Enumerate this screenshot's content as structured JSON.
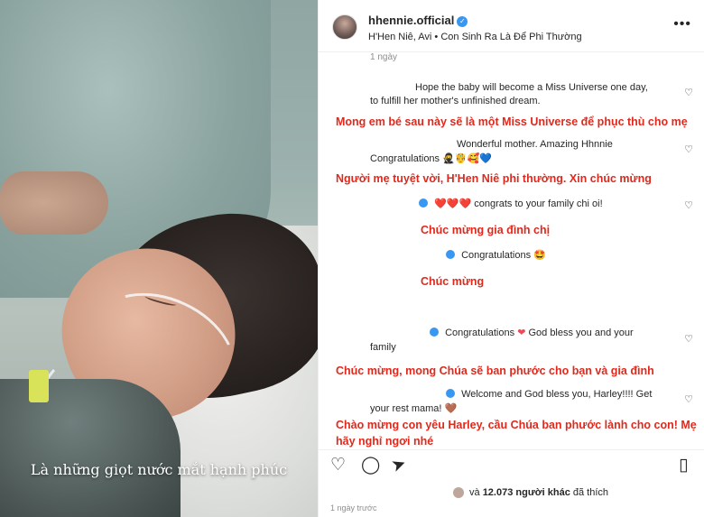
{
  "media": {
    "caption": "Là những giọt nước mắt hạnh phúc"
  },
  "header": {
    "username": "hhennie.official",
    "subtitle": "H'Hen Niê, Avi • Con Sinh Ra Là Để Phi Thường",
    "more_icon": "more-horizontal-icon"
  },
  "comments": {
    "top_timestamp": "1 ngày",
    "c1": {
      "en_line1": "Hope the baby will become a Miss Universe one day,",
      "en_line2": "to fulfill her mother's unfinished dream.",
      "vi": "Mong em bé sau này sẽ là một Miss Universe để phục thù cho mẹ"
    },
    "c2": {
      "en_line1": "Wonderful mother. Amazing Hhnnie",
      "en_line2": "Congratulations",
      "en_emoji": "🥷🤴🥰💙",
      "vi": "Người mẹ tuyệt vời, H'Hen Niê phi thường. Xin chúc mừng"
    },
    "c3": {
      "hearts": "❤️❤️❤️",
      "en": "congrats to your family chi oi!",
      "vi": "Chúc mừng gia đình chị"
    },
    "c4": {
      "en": "Congratulations",
      "emoji": "🤩",
      "vi": "Chúc mừng"
    },
    "c5": {
      "en_a": "Congratulations",
      "en_b": "God bless you and your",
      "en_line2": "family",
      "vi": "Chúc mừng, mong Chúa sẽ ban phước cho bạn và gia đình"
    },
    "c6": {
      "en_line1": "Welcome and God bless you, Harley!!!! Get",
      "en_line2": "your rest mama!",
      "emoji": "🤎",
      "vi_line1": "Chào mừng con yêu Harley, cầu Chúa ban phước lành cho con! Mẹ",
      "vi_line2": "hãy nghỉ ngơi nhé"
    }
  },
  "likes": {
    "prefix": "và",
    "count": "12.073",
    "suffix": "người khác",
    "verb": "đã thích"
  },
  "posted": "1 ngày trước",
  "colors": {
    "accent_red": "#e0291d",
    "verified_blue": "#3897f0"
  }
}
